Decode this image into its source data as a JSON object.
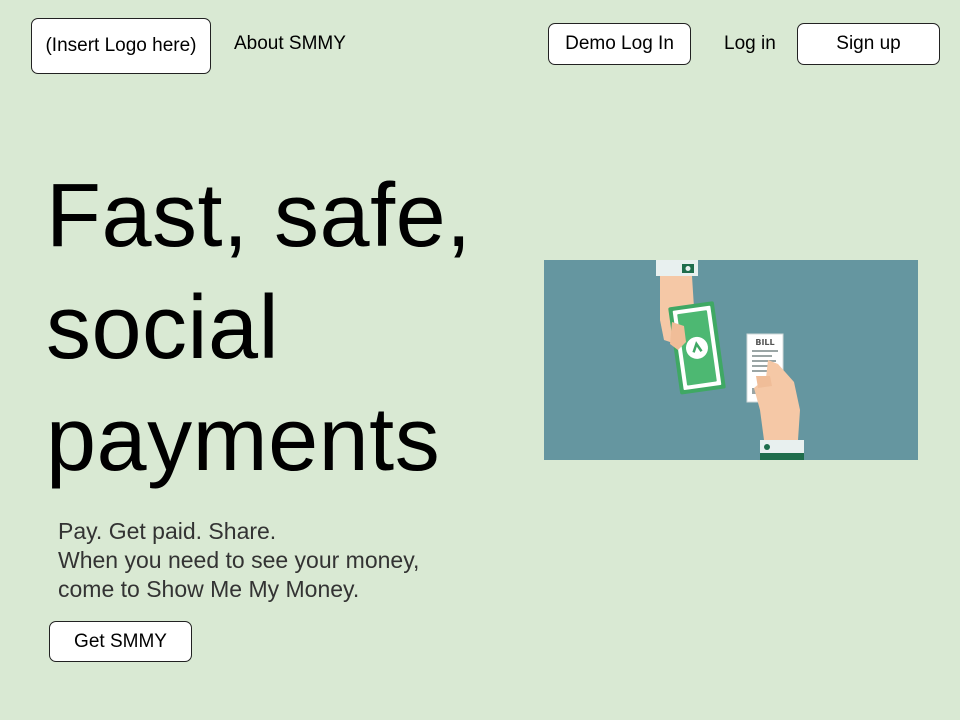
{
  "nav": {
    "logo_label": "(Insert Logo here)",
    "about_label": "About SMMY",
    "demo_login_label": "Demo Log In",
    "login_label": "Log in",
    "signup_label": "Sign up"
  },
  "hero": {
    "headline_lines": [
      "Fast, safe,",
      "social",
      "payments"
    ],
    "tagline_lines": [
      "Pay. Get paid. Share.",
      "When you need to see your money,",
      "come to Show Me My Money."
    ],
    "cta_label": "Get SMMY",
    "illustration": {
      "bill_label": "BILL",
      "icons": [
        "cash-payment-illustration",
        "dollar-icon"
      ],
      "colors": {
        "background": "#6596a0",
        "cash_green": "#3fa864",
        "skin": "#f5c8a6",
        "cuff_dark": "#1f6d4c"
      }
    }
  },
  "colors": {
    "page_background": "#d9e9d3",
    "button_background": "#ffffff",
    "button_border": "#222222",
    "tagline_text": "#333333"
  }
}
